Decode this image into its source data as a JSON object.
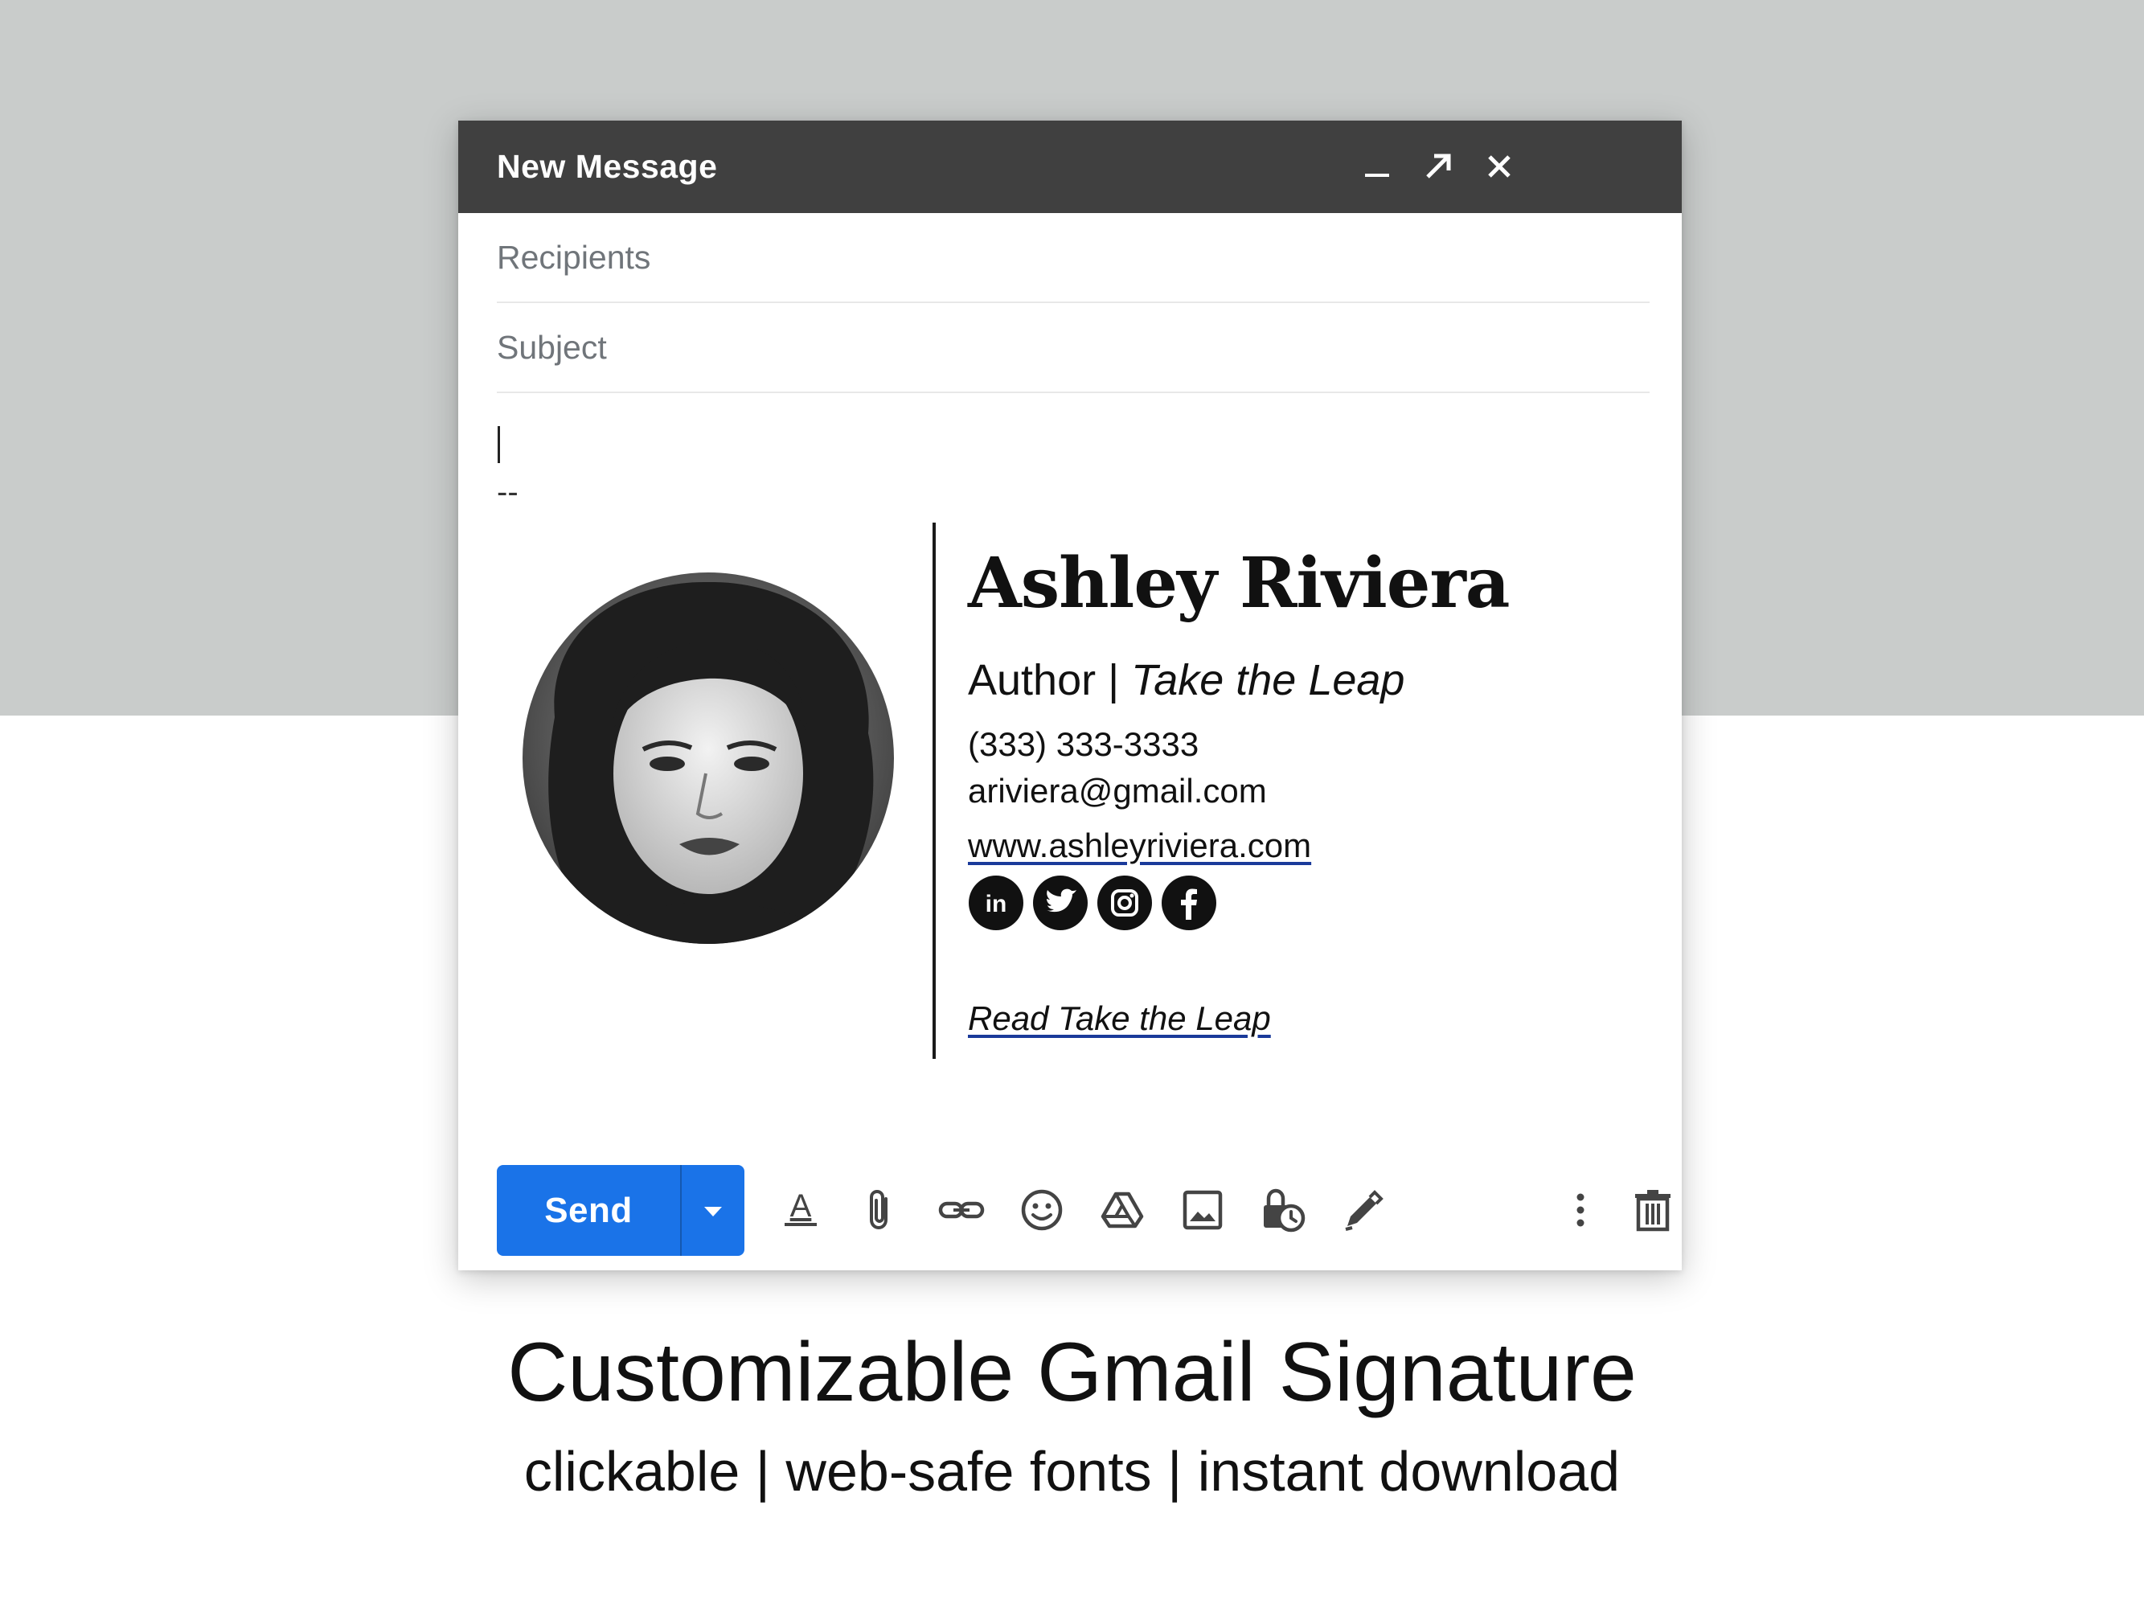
{
  "compose": {
    "title": "New Message",
    "header_icons": [
      "minimize-icon",
      "fullscreen-icon",
      "close-icon"
    ],
    "recipients_placeholder": "Recipients",
    "subject_placeholder": "Subject",
    "signature_delimiter": "--"
  },
  "signature": {
    "name": "Ashley Riviera",
    "role": "Author",
    "role_separator": "|",
    "book": "Take the Leap",
    "phone": "(333) 333-3333",
    "email": "ariviera@gmail.com",
    "website": "www.ashleyriviera.com",
    "social": [
      "linkedin-icon",
      "twitter-icon",
      "instagram-icon",
      "facebook-icon"
    ],
    "cta": "Read Take the Leap"
  },
  "toolbar": {
    "send_label": "Send",
    "icons": [
      "format-text-icon",
      "attach-icon",
      "link-icon",
      "emoji-icon",
      "drive-icon",
      "photo-icon",
      "confidential-icon",
      "signature-icon",
      "more-options-icon",
      "trash-icon"
    ]
  },
  "caption": {
    "title": "Customizable Gmail Signature",
    "subtitle": "clickable | web-safe fonts | instant download"
  },
  "colors": {
    "header": "#404040",
    "send": "#1a73e8",
    "background_band": "#c9cccb"
  }
}
